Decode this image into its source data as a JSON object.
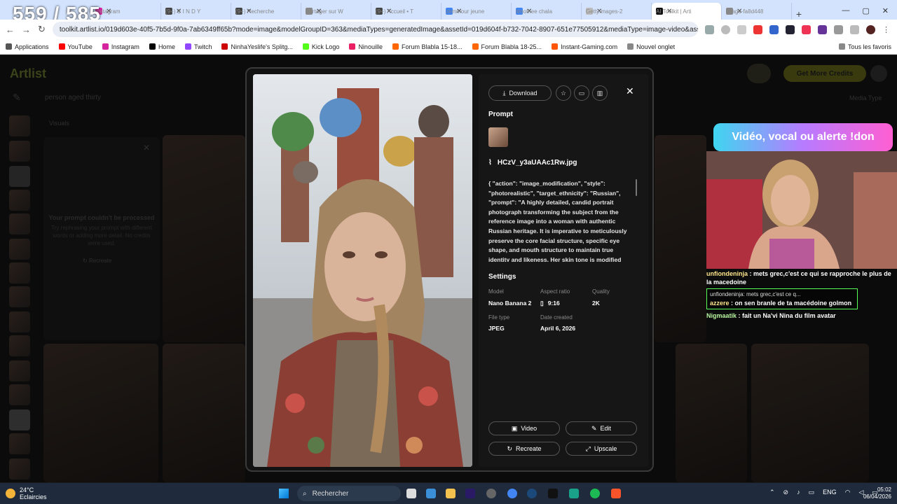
{
  "overlay_counter": "559 / 585",
  "tabs": [
    {
      "label": "Instagram",
      "color": "#d6249f"
    },
    {
      "label": "(9+) C I N D Y",
      "color": "#444"
    },
    {
      "label": "(9+) Recherche",
      "color": "#444"
    },
    {
      "label": "Partager sur W",
      "color": "#888"
    },
    {
      "label": "(9+) Accueil • T",
      "color": "#444"
    },
    {
      "label": "zemmour jeune",
      "color": "#4285f4"
    },
    {
      "label": "timothee chala",
      "color": "#4285f4"
    },
    {
      "label": "GettyImages-2",
      "color": "#bbb"
    },
    {
      "label": "AI Toolkit | Arti",
      "color": "#111"
    },
    {
      "label": "image-fa8d448",
      "color": "#888"
    }
  ],
  "address_bar": {
    "url": "toolkit.artlist.io/019d603e-40f5-7b5d-9f0a-7ab6349ff65b?mode=image&modelGroupID=363&mediaTypes=generatedImage&assetId=019d604f-b732-7042-8907-651e77505912&mediaType=image-video&assetWi..."
  },
  "bookmarks": [
    {
      "label": "Applications",
      "color": "#555"
    },
    {
      "label": "YouTube",
      "color": "#f00"
    },
    {
      "label": "Instagram",
      "color": "#d6249f"
    },
    {
      "label": "Home",
      "color": "#000"
    },
    {
      "label": "Twitch",
      "color": "#9146ff"
    },
    {
      "label": "NinhaYeslife's Splitg...",
      "color": "#c00"
    },
    {
      "label": "Kick Logo",
      "color": "#53fc18"
    },
    {
      "label": "Ninouille",
      "color": "#e91e63"
    },
    {
      "label": "Forum Blabla 15-18...",
      "color": "#ff6600"
    },
    {
      "label": "Forum Blabla 18-25...",
      "color": "#ff6600"
    },
    {
      "label": "Instant-Gaming.com",
      "color": "#ff5400"
    },
    {
      "label": "Nouvel onglet",
      "color": "#888"
    }
  ],
  "bookmarks_right": "Tous les favoris",
  "app": {
    "logo": "Artlist",
    "get_credits": "Get More Credits",
    "search_query": "person aged thirty",
    "media_type": "Media Type",
    "visuals_label": "Visuals",
    "error_title": "Your prompt couldn't be processed",
    "error_sub": "Try rephrasing your prompt with different words or adding more detail. No credits were used.",
    "recreate_small": "Recreate"
  },
  "modal": {
    "download": "Download",
    "prompt_heading": "Prompt",
    "file_name": "HCzV_y3aUAAc1Rw.jpg",
    "prompt_text": "{ \"action\": \"image_modification\", \"style\": \"photorealistic\", \"target_ethnicity\": \"Russian\", \"prompt\": \"A highly detailed, candid portrait photograph transforming the subject from the reference image into a woman with authentic Russian heritage. It is imperative to meticulously preserve the core facial structure, specific eye shape, and mouth structure to maintain true identity and likeness. Her skin tone is modified",
    "settings_heading": "Settings",
    "settings": {
      "model_label": "Model",
      "model": "Nano Banana 2",
      "aspect_label": "Aspect ratio",
      "aspect": "9:16",
      "quality_label": "Quality",
      "quality": "2K",
      "filetype_label": "File type",
      "filetype": "JPEG",
      "date_label": "Date created",
      "date": "April 6, 2026"
    },
    "actions": {
      "video": "Video",
      "edit": "Edit",
      "recreate": "Recreate",
      "upscale": "Upscale"
    }
  },
  "stream": {
    "banner": "Vidéo, vocal ou alerte !don",
    "chat": [
      {
        "user": "unfiondeninja",
        "text": "mets grec,c'est ce qui se rapproche le plus de la macedoine"
      },
      {
        "reply_quote": "unfiondeninja: mets grec,c'est ce q...",
        "user": "azzere",
        "text": "on sen branle de ta macédoine golmon"
      },
      {
        "user": "Nigmaatik",
        "text": "fait un Na'vi Nina du film avatar"
      }
    ]
  },
  "taskbar": {
    "temp": "24°C",
    "weather": "Eclaircies",
    "search": "Rechercher",
    "lang": "ENG",
    "time": "05:02",
    "date": "06/04/2026"
  }
}
